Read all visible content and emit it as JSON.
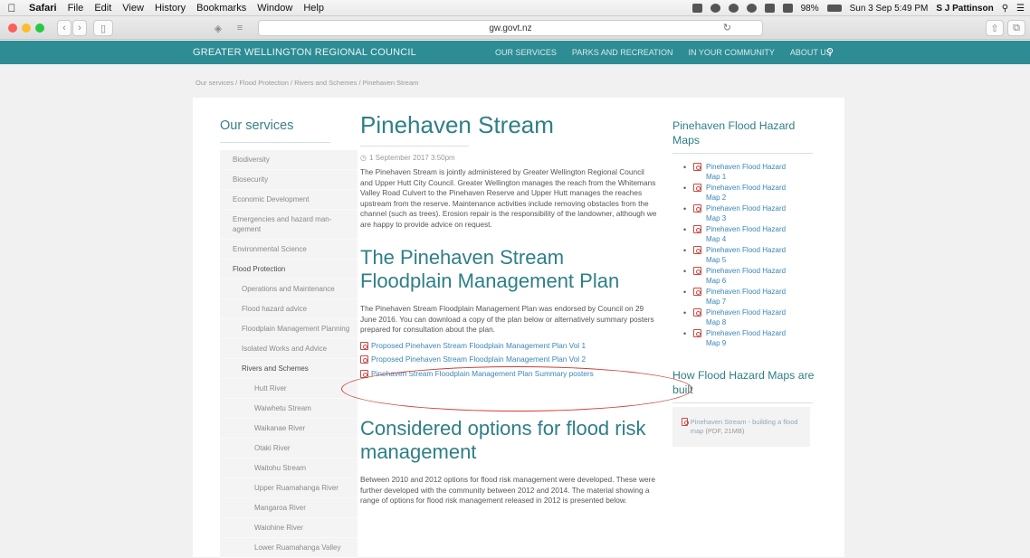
{
  "menubar": {
    "items": [
      "Safari",
      "File",
      "Edit",
      "View",
      "History",
      "Bookmarks",
      "Window",
      "Help"
    ],
    "battery": "98%",
    "clock": "Sun 3 Sep  5:49 PM",
    "user": "S J Pattinson"
  },
  "browser": {
    "url": "gw.govt.nz"
  },
  "site": {
    "brand": "GREATER WELLINGTON REGIONAL COUNCIL",
    "nav": [
      "OUR SERVICES",
      "PARKS AND RECREATION",
      "IN YOUR COMMUNITY",
      "ABOUT US"
    ],
    "breadcrumb": "Our services / Flood Protection / Rivers and Schemes / Pinehaven Stream"
  },
  "sidebar": {
    "title": "Our services",
    "items": [
      {
        "label": "Biodiversity",
        "level": 1
      },
      {
        "label": "Biosecurity",
        "level": 1
      },
      {
        "label": "Economic Development",
        "level": 1
      },
      {
        "label": "Emergencies and hazard man-agement",
        "level": 1
      },
      {
        "label": "Environmental Science",
        "level": 1
      },
      {
        "label": "Flood Protection",
        "level": 1,
        "active": true
      },
      {
        "label": "Operations and Maintenance",
        "level": 2
      },
      {
        "label": "Flood hazard advice",
        "level": 2
      },
      {
        "label": "Floodplain Management Planning",
        "level": 2
      },
      {
        "label": "Isolated Works and Advice",
        "level": 2
      },
      {
        "label": "Rivers and Schemes",
        "level": 2,
        "active": true
      },
      {
        "label": "Hutt River",
        "level": 3
      },
      {
        "label": "Waiwhetu Stream",
        "level": 3
      },
      {
        "label": "Waikanae River",
        "level": 3
      },
      {
        "label": "Otaki River",
        "level": 3
      },
      {
        "label": "Waitohu Stream",
        "level": 3
      },
      {
        "label": "Upper Ruamahanga River",
        "level": 3
      },
      {
        "label": "Mangaroa River",
        "level": 3
      },
      {
        "label": "Waiohine River",
        "level": 3
      },
      {
        "label": "Lower Ruamahanga Valley",
        "level": 3
      }
    ]
  },
  "article": {
    "title": "Pinehaven Stream",
    "date": "1 September 2017 3:50pm",
    "intro": "The Pinehaven Stream is jointly administered by Greater Wellington Regional Council and Upper Hutt City Council. Greater Wellington manages the reach from the Whitemans Valley Road Culvert to the Pinehaven Reserve and Upper Hutt manages the reaches upstream from the reserve. Maintenance activities include removing obstacles from the channel (such as trees). Erosion repair is the responsibility of the landowner, although we are happy to provide advice on request.",
    "section1_title": "The Pinehaven Stream Floodplain Management Plan",
    "section1_text": "The Pinehaven Stream Floodplain Management Plan was endorsed by Council on 29 June 2016. You can download a copy of the plan below or alternatively summary posters prepared for consultation about the plan.",
    "links": [
      "Proposed Pinehaven Stream Floodplain Management Plan  Vol 1",
      "Proposed Pinehaven Stream Floodplain Management Plan  Vol 2",
      "Pinehaven Stream Floodplain Management Plan Summary posters"
    ],
    "section2_title": "Considered options for flood risk management",
    "section2_text": "Between 2010 and 2012 options for flood risk management were developed. These were further developed with the community between 2012 and 2014. The material showing a range of options for flood risk management released in 2012 is presented below."
  },
  "right": {
    "maps_title": "Pinehaven Flood Hazard Maps",
    "maps": [
      "Pinehaven Flood Hazard Map 1",
      "Pinehaven Flood Hazard Map 2",
      "Pinehaven Flood Hazard Map 3",
      "Pinehaven Flood Hazard Map 4",
      "Pinehaven Flood Hazard Map 5",
      "Pinehaven Flood Hazard Map 6",
      "Pinehaven Flood Hazard Map 7",
      "Pinehaven Flood Hazard Map 8",
      "Pinehaven Flood Hazard Map 9"
    ],
    "built_title": "How Flood Hazard Maps are built",
    "built_link": "Pinehaven Stream - building a flood map",
    "built_size": "(PDF, 21MB)"
  },
  "colors": {
    "header_teal": "#2d8c94",
    "heading_teal": "#2e7f86",
    "link_blue": "#3a86b8",
    "annotation_red": "#cc3e34"
  }
}
